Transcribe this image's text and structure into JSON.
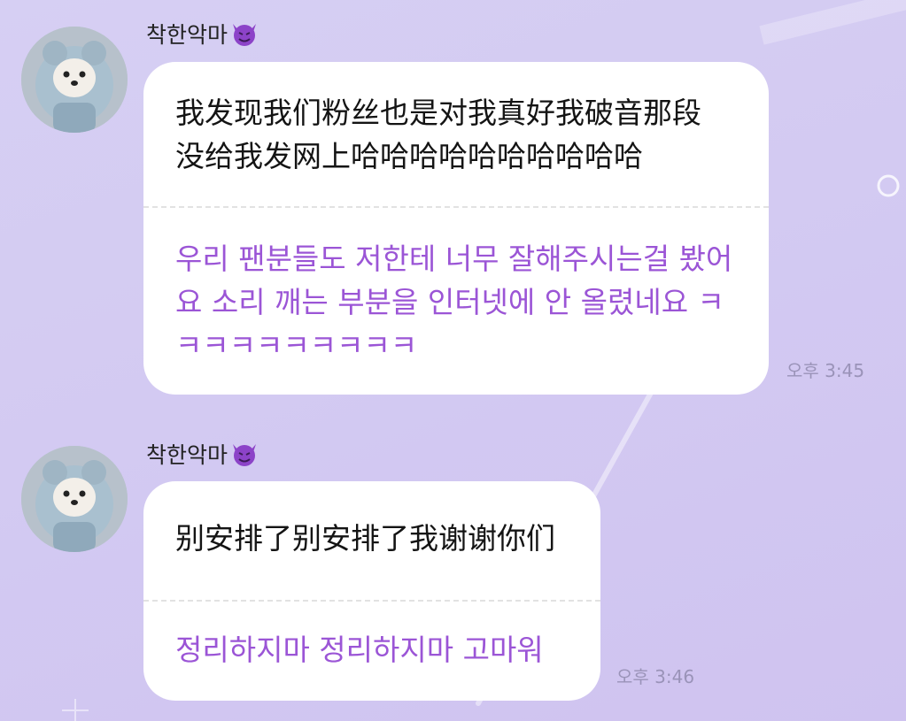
{
  "messages": [
    {
      "sender": "착한악마",
      "original": "我发现我们粉丝也是对我真好我破音那段\n没给我发网上哈哈哈哈哈哈哈哈哈哈",
      "translation": "우리 팬분들도 저한테 너무 잘해주시는걸 봤어\n요 소리 깨는 부분을 인터넷에 안 올렸네요 ㅋ\nㅋㅋㅋㅋㅋㅋㅋㅋㅋ",
      "time": "오후 3:45"
    },
    {
      "sender": "착한악마",
      "original": "别安排了别安排了我谢谢你们",
      "translation": "정리하지마 정리하지마 고마워",
      "time": "오후 3:46"
    }
  ],
  "colors": {
    "background": "#d5cdf2",
    "bubble": "#ffffff",
    "translation_text": "#9b55d6",
    "timestamp": "#9a93b8"
  },
  "icons": {
    "sender_emoji": "smiling-face-with-horns",
    "avatar": "dog-in-blue-hoodie"
  }
}
